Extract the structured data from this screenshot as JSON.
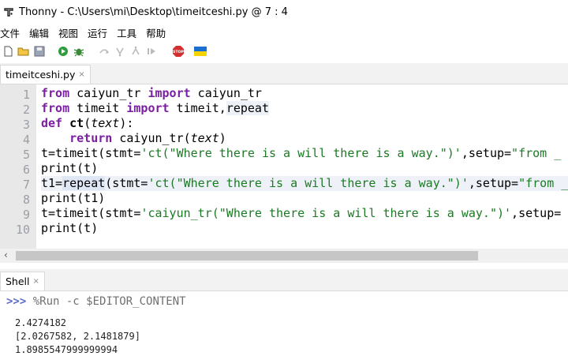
{
  "window": {
    "title": "Thonny  -  C:\\Users\\mi\\Desktop\\timeitceshi.py  @  7 : 4"
  },
  "menu": [
    "文件",
    "编辑",
    "视图",
    "运行",
    "工具",
    "帮助"
  ],
  "editor": {
    "tab": {
      "label": "timeitceshi.py",
      "close": "×"
    },
    "line_numbers": [
      "1",
      "2",
      "3",
      "4",
      "5",
      "6",
      "7",
      "8",
      "9",
      "10"
    ]
  },
  "code": {
    "l1": {
      "kw1": "from",
      "t1": " caiyun_tr ",
      "kw2": "import",
      "t2": " caiyun_tr"
    },
    "l2": {
      "kw1": "from",
      "t1": " timeit ",
      "kw2": "import",
      "t2": " timeit,",
      "t3": "repeat"
    },
    "l3": {
      "kw1": "def",
      "t1": " ",
      "fn": "ct",
      "t2": "(",
      "param": "text",
      "t3": "):"
    },
    "l4": {
      "indent": "    ",
      "kw1": "return",
      "t1": " caiyun_tr(",
      "param": "text",
      "t2": ")"
    },
    "l5": {
      "t1": "t=timeit(stmt=",
      "s1": "'ct(\"Where there is a will there is a way.\")'",
      "t2": ",setup=",
      "s2": "\"from _"
    },
    "l6": {
      "t1": "print(t)"
    },
    "l7": {
      "t1": "t1=",
      "t2": "repeat",
      "t3": "(stmt=",
      "s1": "'ct(\"Where there is a will there is a way.\")'",
      "t4": ",setup=",
      "s2": "\"from _"
    },
    "l8": {
      "t1": "print(t1)"
    },
    "l9": {
      "t1": "t=timeit(stmt=",
      "s1": "'caiyun_tr(\"Where there is a will there is a way.\")'",
      "t2": ",setup="
    },
    "l10": {
      "t1": "print(t)"
    }
  },
  "shell": {
    "tab": {
      "label": "Shell",
      "close": "×"
    },
    "prompt": ">>>",
    "command": "%Run -c $EDITOR_CONTENT",
    "output": [
      "2.4274182",
      "[2.0267582, 2.1481879]",
      "1.8985547999999994"
    ]
  },
  "colors": {
    "keyword": "#7b1fa2",
    "string": "#1b7a24",
    "stop": "#d32f2f",
    "run": "#2e9e3e"
  },
  "icons": [
    "thonny-app-icon",
    "new-file-icon",
    "open-file-icon",
    "save-file-icon",
    "run-icon",
    "debug-icon",
    "step-over-icon",
    "step-into-icon",
    "step-out-icon",
    "resume-icon",
    "stop-icon",
    "ukraine-flag-icon"
  ]
}
